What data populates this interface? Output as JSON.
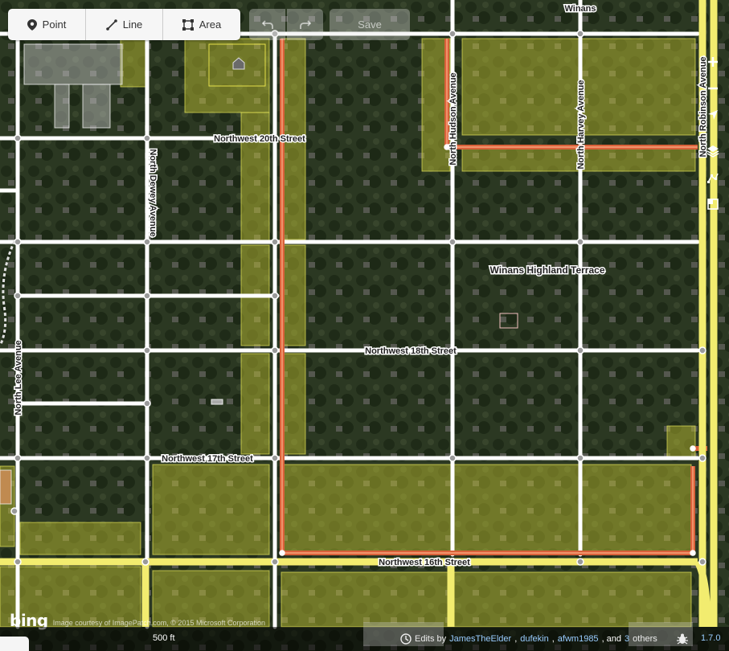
{
  "toolbar": {
    "point_label": "Point",
    "line_label": "Line",
    "area_label": "Area",
    "save_label": "Save"
  },
  "map": {
    "place_label": "Winans",
    "neighborhood_label": "Winans Highland Terrace",
    "streets": {
      "nw20": "Northwest 20th Street",
      "nw18": "Northwest 18th Street",
      "nw17": "Northwest 17th Street",
      "nw16": "Northwest 16th Street",
      "n_hudson": "North Hudson Avenue",
      "n_harvey": "North Harvey Avenue",
      "n_robinson": "North Robinson Avenue",
      "n_dewey": "North Dewey Avenue",
      "n_lee": "North Lee Avenue"
    }
  },
  "attribution": {
    "bing": "bing",
    "text": "Image courtesy of ImagePatch.com, © 2015 Microsoft Corporation"
  },
  "footer": {
    "scale": "500 ft",
    "edits_prefix": "Edits by",
    "editor1": "JamesTheElder",
    "sep1": ",",
    "editor2": "dufekin",
    "sep2": ",",
    "editor3": "afwm1985",
    "and_text": ", and",
    "others_count": "3",
    "others_text": "others",
    "version": "1.7.0"
  },
  "colors": {
    "yellow_overlay": "#c8c83a",
    "primary_road": "#e06a3c",
    "trunk_road": "#f0ea6a",
    "minor_road": "#ffffff"
  }
}
